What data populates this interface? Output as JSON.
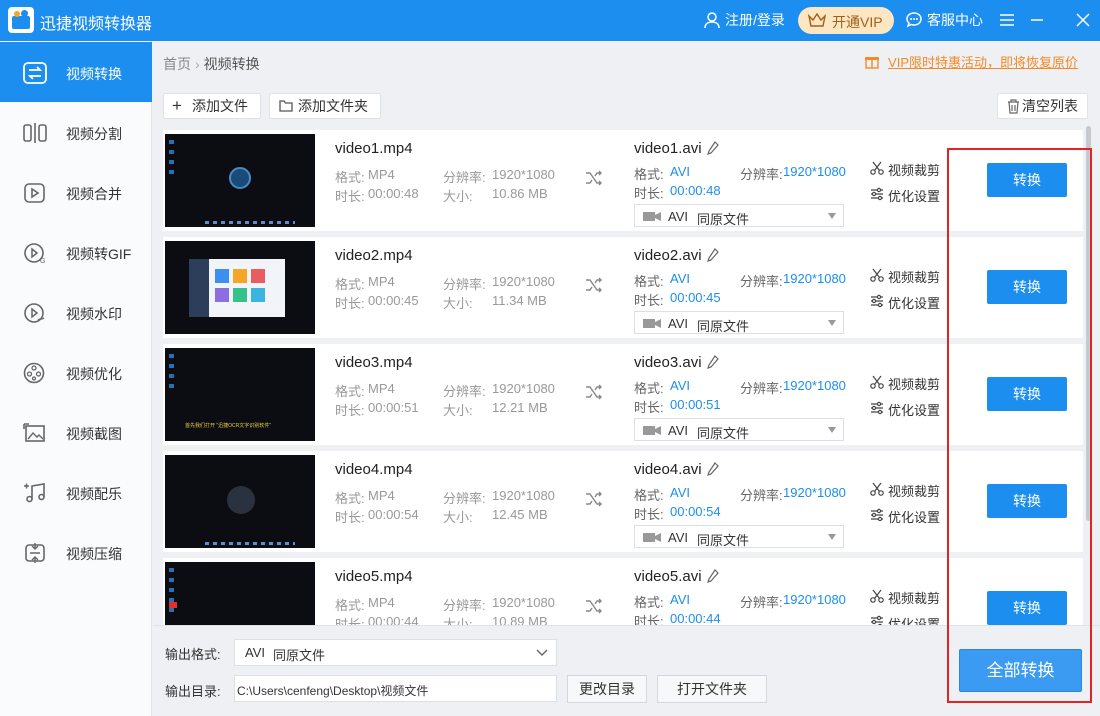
{
  "app": {
    "title": "迅捷视频转换器"
  },
  "titlebar": {
    "login": "注册/登录",
    "vip": "开通VIP",
    "service": "客服中心"
  },
  "sidebar": {
    "items": [
      {
        "label": "视频转换",
        "active": true
      },
      {
        "label": "视频分割"
      },
      {
        "label": "视频合并"
      },
      {
        "label": "视频转GIF"
      },
      {
        "label": "视频水印"
      },
      {
        "label": "视频优化"
      },
      {
        "label": "视频截图"
      },
      {
        "label": "视频配乐"
      },
      {
        "label": "视频压缩"
      }
    ]
  },
  "breadcrumb": {
    "home": "首页",
    "current": "视频转换"
  },
  "promo": "VIP限时特惠活动，即将恢复原价",
  "toolbar": {
    "add_file": "添加文件",
    "add_folder": "添加文件夹",
    "clear": "清空列表"
  },
  "labels": {
    "format": "格式:",
    "duration": "时长:",
    "resolution": "分辨率:",
    "size": "大小:",
    "crop": "视频裁剪",
    "optimize": "优化设置",
    "convert": "转换",
    "select_format": "AVI",
    "select_quality": "同原文件"
  },
  "files": [
    {
      "name": "video1.mp4",
      "src_format": "MP4",
      "duration": "00:00:48",
      "resolution": "1920*1080",
      "size": "10.86 MB",
      "out_name": "video1.avi",
      "out_format": "AVI",
      "out_duration": "00:00:48",
      "out_resolution": "1920*1080"
    },
    {
      "name": "video2.mp4",
      "src_format": "MP4",
      "duration": "00:00:45",
      "resolution": "1920*1080",
      "size": "11.34 MB",
      "out_name": "video2.avi",
      "out_format": "AVI",
      "out_duration": "00:00:45",
      "out_resolution": "1920*1080"
    },
    {
      "name": "video3.mp4",
      "src_format": "MP4",
      "duration": "00:00:51",
      "resolution": "1920*1080",
      "size": "12.21 MB",
      "out_name": "video3.avi",
      "out_format": "AVI",
      "out_duration": "00:00:51",
      "out_resolution": "1920*1080"
    },
    {
      "name": "video4.mp4",
      "src_format": "MP4",
      "duration": "00:00:54",
      "resolution": "1920*1080",
      "size": "12.45 MB",
      "out_name": "video4.avi",
      "out_format": "AVI",
      "out_duration": "00:00:54",
      "out_resolution": "1920*1080"
    },
    {
      "name": "video5.mp4",
      "src_format": "MP4",
      "duration": "00:00:44",
      "resolution": "1920*1080",
      "size": "10.89 MB",
      "out_name": "video5.avi",
      "out_format": "AVI",
      "out_duration": "00:00:44",
      "out_resolution": "1920*1080"
    }
  ],
  "thumb_caption": "首先我们打开 \"迅捷OCR文字识别软件\"",
  "bottom": {
    "format_label": "输出格式:",
    "format_value": "AVI",
    "format_quality": "同原文件",
    "dir_label": "输出目录:",
    "dir_value": "C:\\Users\\cenfeng\\Desktop\\视频文件",
    "change_dir": "更改目录",
    "open_folder": "打开文件夹",
    "convert_all": "全部转换"
  },
  "colors": {
    "primary": "#1b8ef0",
    "vip_bg": "#fde6c2",
    "promo": "#f28b26",
    "highlight": "#e12424"
  }
}
